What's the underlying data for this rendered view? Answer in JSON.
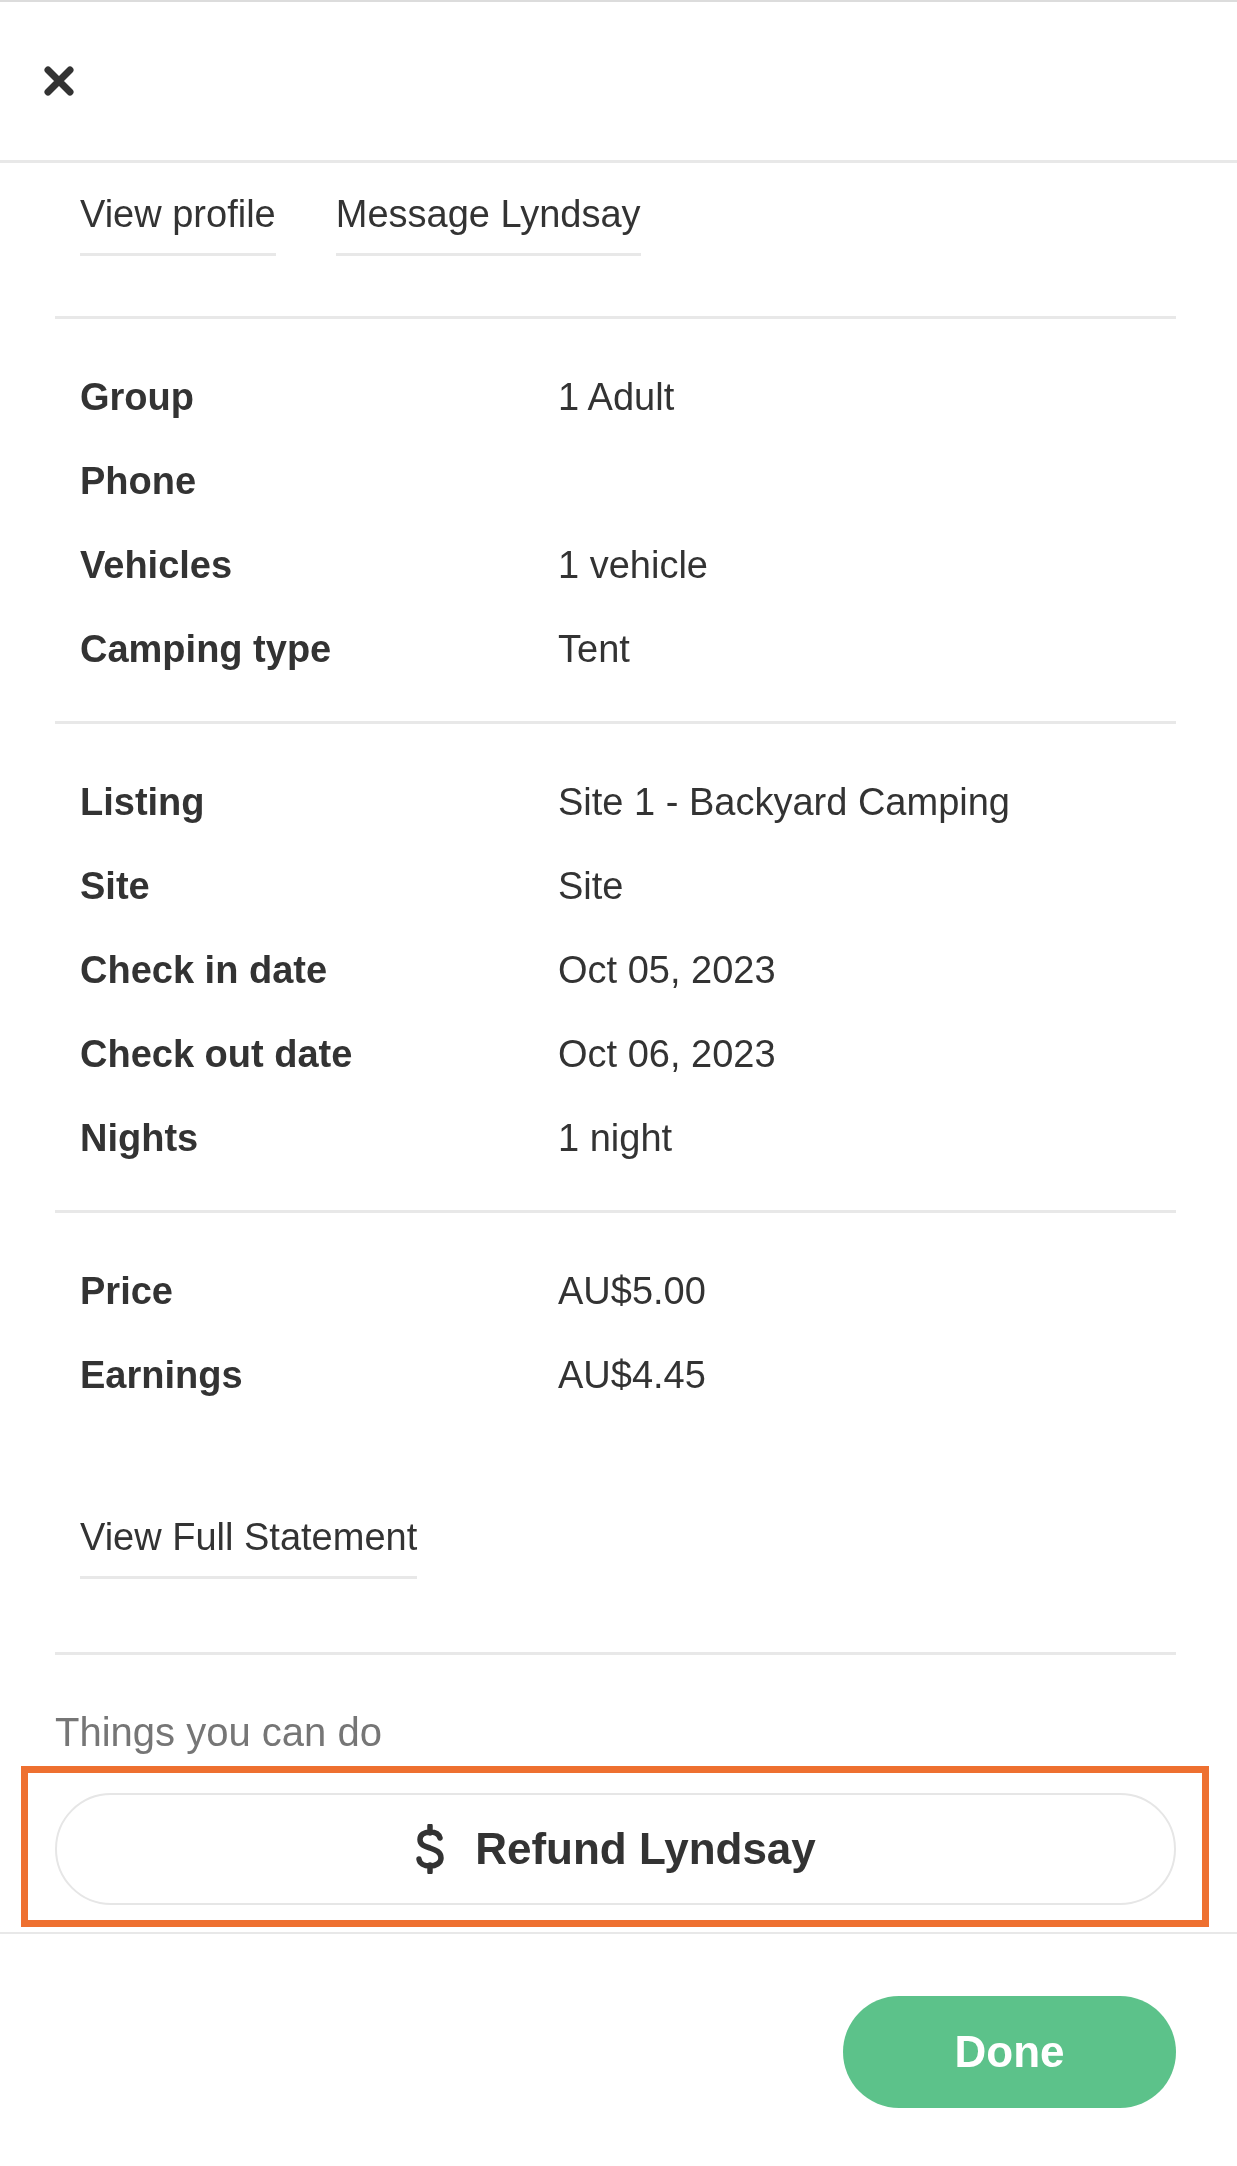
{
  "profile_links": [
    {
      "label": "View profile"
    },
    {
      "label": "Message Lyndsay"
    }
  ],
  "sections": [
    {
      "rows": [
        {
          "label": "Group",
          "value": "1 Adult"
        },
        {
          "label": "Phone"
        },
        {
          "label": "Vehicles",
          "value": "1 vehicle"
        },
        {
          "label": "Camping type",
          "value": "Tent"
        }
      ]
    },
    {
      "rows": [
        {
          "label": "Listing",
          "value": "Site 1 - Backyard Camping"
        },
        {
          "label": "Site",
          "value": "Site"
        },
        {
          "label": "Check in date",
          "value": "Oct 05, 2023"
        },
        {
          "label": "Check out date",
          "value": "Oct 06, 2023"
        },
        {
          "label": "Nights",
          "value": "1 night"
        }
      ]
    },
    {
      "rows": [
        {
          "label": "Price",
          "value": "AU$5.00"
        },
        {
          "label": "Earnings",
          "value": "AU$4.45"
        }
      ],
      "link": "View Full Statement"
    }
  ],
  "actions": {
    "heading": "Things you can do",
    "items": [
      {
        "label": "Refund Lyndsay",
        "highlighted": true
      }
    ]
  },
  "footer": {
    "done_button": "Done"
  }
}
